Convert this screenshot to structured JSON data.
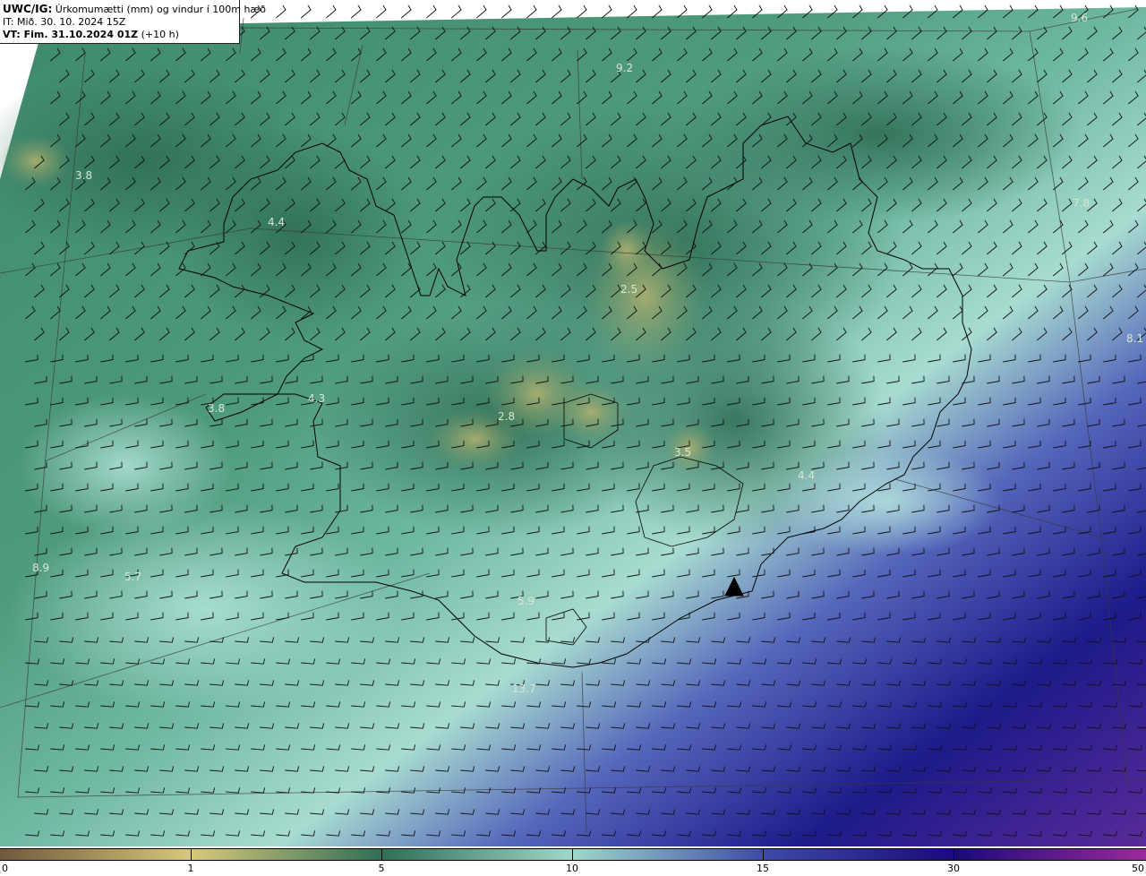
{
  "header": {
    "model": "UWC/IG:",
    "title": " Úrkomumætti (mm) og vindur í 100m hæð",
    "issue_time": "IT: Mið. 30. 10. 2024 15Z",
    "valid_prefix": "VT: Fim. 31.10.2024 01Z",
    "valid_suffix": " (+10 h)"
  },
  "values": [
    {
      "text": "9.6",
      "lon_lat": "ne-corner",
      "key": "v1"
    },
    {
      "text": "9.2",
      "key": "v2"
    },
    {
      "text": "3.8",
      "key": "v3"
    },
    {
      "text": "4.4",
      "key": "v4"
    },
    {
      "text": "7.8",
      "key": "v5"
    },
    {
      "text": "2.5",
      "key": "v6"
    },
    {
      "text": "8.1",
      "key": "v7"
    },
    {
      "text": "4.3",
      "key": "v8"
    },
    {
      "text": "3.8",
      "key": "v9"
    },
    {
      "text": "2.8",
      "key": "v10"
    },
    {
      "text": "3.5",
      "key": "v11"
    },
    {
      "text": "4.4",
      "key": "v12"
    },
    {
      "text": "8.9",
      "key": "v13"
    },
    {
      "text": "5.7",
      "key": "v14"
    },
    {
      "text": "5.9",
      "key": "v15"
    },
    {
      "text": "13.7",
      "key": "v16"
    }
  ],
  "colorbar": {
    "ticks": [
      "0",
      "1",
      "5",
      "10",
      "15",
      "30",
      "50"
    ],
    "colors": [
      "#6e5a3c",
      "#d8c87a",
      "#2f6e55",
      "#9fd8c8",
      "#3d4aa8",
      "#1b0a7a",
      "#9a2a9a"
    ]
  }
}
